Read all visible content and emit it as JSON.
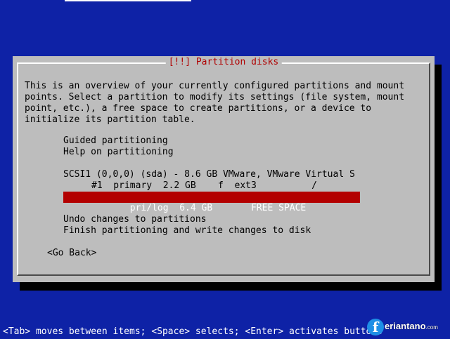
{
  "dialog": {
    "title": "[!!] Partition disks",
    "description": [
      "This is an overview of your currently configured partitions and mount",
      "points. Select a partition to modify its settings (file system, mount",
      "point, etc.), a free space to create partitions, or a device to",
      "initialize its partition table."
    ],
    "menu": {
      "guided": "Guided partitioning",
      "help": "Help on partitioning",
      "device": "SCSI1 (0,0,0) (sda) - 8.6 GB VMware, VMware Virtual S",
      "partition1": "#1  primary  2.2 GB    f  ext3          /",
      "free_space": "   pri/log  6.4 GB       FREE SPACE",
      "undo": "Undo changes to partitions",
      "finish": "Finish partitioning and write changes to disk"
    },
    "go_back": "<Go Back>"
  },
  "status_bar": "<Tab> moves between items; <Space> selects; <Enter> activates buttons",
  "watermark": {
    "letter": "f",
    "text": "eriantano",
    "suffix": ".com"
  },
  "colors": {
    "background": "#0e22a6",
    "dialog": "#bdbdbd",
    "title": "#b00000",
    "selection": "#b30000"
  }
}
